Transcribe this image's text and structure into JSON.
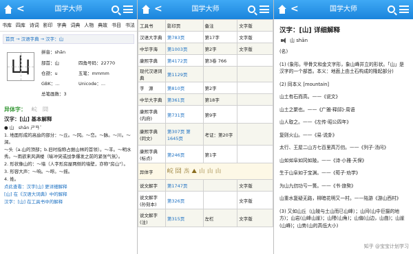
{
  "app_title": "国学大师",
  "p1": {
    "nav_tabs": [
      "书库",
      "四库",
      "诗词",
      "影印",
      "字典",
      "词典",
      "人物",
      "典故",
      "书目",
      "书法"
    ],
    "breadcrumb": "首页 → 汉语字典 → 汉字：山",
    "char": "山",
    "pinyin": "拼音：shān",
    "radical": "部首：山",
    "four_corner": "四角号码：22770",
    "strokes": "仓颉：u",
    "wubi": "五笔：mmmm",
    "gbk": "GBK：...",
    "unicode": "Unicode：...",
    "stroke_count": "总笔画数：3",
    "variants_label": "异体字：",
    "variants": [
      "𡷗",
      "𡶬"
    ],
    "basic_head": "汉字：[山] 基本解释",
    "basic_pron": "● 山　shān ㄕㄢˉ",
    "def1": "1. 地面形成的高耸的部分：～丘。～冈。～峦。～脉。～川。～涧。",
    "def2": "～头（a.山的顶部；b.旧时指称占据山林的首领）。～羊。～明水秀。～雨欲来风满楼（喻冲突或战争爆发之前的紧张气氛）。",
    "def3": "2. 形状像山的：～墙（人字形房屋两侧的墙壁，亦称\"房山\"）。",
    "def4": "3. 形容大声：～响。～呼。～摇。",
    "def5": "4. 姓。",
    "link1": "点此查看：汉字[山] 更详细解释",
    "link2": "[山] 在《汉语大词典》中的解释",
    "link3": "汉字：[山] 在工具书中的解释"
  },
  "p2": {
    "header": [
      "工具书",
      "影印页",
      "备注",
      "文字版"
    ],
    "rows": [
      [
        "汉语大字典",
        "第783页",
        "第17字",
        "文字版"
      ],
      [
        "中华字海",
        "第1003页",
        "第2字",
        "文字版"
      ],
      [
        "康熙字典",
        "第4172页",
        "第3卷 766",
        ""
      ],
      [
        "现代汉语词典",
        "第1129页",
        "",
        ""
      ],
      [
        "字　源",
        "第810页",
        "第2字",
        ""
      ],
      [
        "中华大字典",
        "第361页",
        "第18字",
        ""
      ],
      [
        "康熙字典(内府)",
        "第731页",
        "第9字",
        ""
      ],
      [
        "康熙字典(同文)",
        "第307页 第1645页",
        "考证：第20字",
        ""
      ],
      [
        "康熙字典(标点)",
        "第246页",
        "第1字",
        ""
      ],
      [
        "异体字",
        "",
        "",
        ""
      ],
      [
        "说文解字",
        "第1747页",
        "",
        "文字版"
      ],
      [
        "说文解字(孙刻本)",
        "第326页",
        "",
        "文字版"
      ],
      [
        "说文解字(注)",
        "第315页",
        "左栏",
        "文字版"
      ]
    ],
    "glyph_row": "𡷗 𡶬 𡷀 ⛰ 山 山 山"
  },
  "p3": {
    "heading": "汉字：[山] 详细解释",
    "pinyin": "山 shān",
    "lines": [
      "(名)",
      "(1) (象形。甲骨文和金文字形，象山峰并立的形状。「山」是汉字的一个部首。本义：地面上由土石构成的隆起部分)",
      "(2) 同本义 [mountain]",
      "山土有石而高。——《说文》",
      "山土之聚也。——《广雅·释邱》·周语",
      "山人取之。——《左传·昭公四年》",
      "复则火山。——《易·说卦》",
      "太行、王屋二山方七百里高万仞。——《列子·汤问》",
      "山如如阜如冈如陵。——《诗·小雅·天保》",
      "生于山阜如于宝渊。——《荀子·劝学》",
      "为山九仞功亏一篑。——《书·旅獒》",
      "山重水复疑无路，柳暗花明又一村。——陆游《游山西村》",
      "(3) 又如山丘（山陵与土山而已山峰）；山间(山中巨摄的地方)；山岩(山峰山崖)；山隈(山角)；山偏(山边，山曲)；山崖(山峰)；山势(山的高低大小)"
    ],
    "watermark": "知乎 @宝宝计划学习"
  }
}
